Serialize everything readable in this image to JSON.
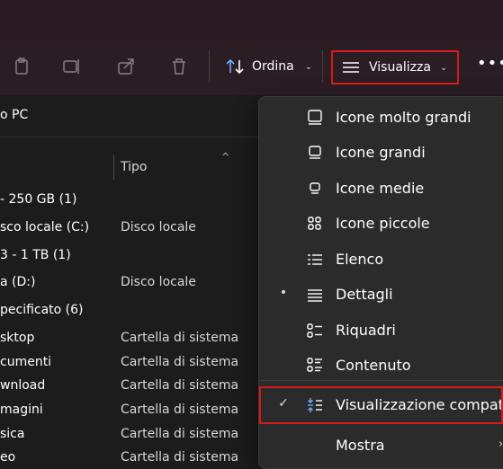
{
  "toolbar": {
    "sort_label": "Ordina",
    "view_label": "Visualizza",
    "more_label": "•••"
  },
  "address": {
    "text": "o PC"
  },
  "columns": {
    "type_header": "Tipo"
  },
  "groups": [
    {
      "label": "- 250 GB (1)"
    },
    {
      "label": "3 - 1 TB (1)"
    },
    {
      "label": "pecificato (6)"
    }
  ],
  "rows": [
    {
      "name": "sco locale (C:)",
      "type": "Disco locale"
    },
    {
      "name": "a (D:)",
      "type": "Disco locale"
    },
    {
      "name": "sktop",
      "type": "Cartella di sistema"
    },
    {
      "name": "cumenti",
      "type": "Cartella di sistema"
    },
    {
      "name": "wnload",
      "type": "Cartella di sistema"
    },
    {
      "name": "magini",
      "type": "Cartella di sistema"
    },
    {
      "name": "sica",
      "type": "Cartella di sistema"
    },
    {
      "name": "eo",
      "type": "Cartella di sistema"
    }
  ],
  "view_menu": {
    "items": [
      {
        "label": "Icone molto grandi",
        "icon": "monitor-large-icon",
        "mark": ""
      },
      {
        "label": "Icone grandi",
        "icon": "monitor-icon",
        "mark": ""
      },
      {
        "label": "Icone medie",
        "icon": "monitor-small-icon",
        "mark": ""
      },
      {
        "label": "Icone piccole",
        "icon": "grid-icon",
        "mark": ""
      },
      {
        "label": "Elenco",
        "icon": "list-icon",
        "mark": ""
      },
      {
        "label": "Dettagli",
        "icon": "details-icon",
        "mark": "•"
      },
      {
        "label": "Riquadri",
        "icon": "tiles-icon",
        "mark": ""
      },
      {
        "label": "Contenuto",
        "icon": "content-icon",
        "mark": ""
      },
      {
        "label": "Visualizzazione compatta",
        "icon": "compact-icon",
        "mark": "✓"
      },
      {
        "label": "Mostra",
        "icon": "",
        "mark": "",
        "arrow": "›"
      }
    ]
  },
  "colors": {
    "highlight": "#d71b1b",
    "toolbar_bg": "#2b1d24",
    "menu_bg": "#2b2b2b"
  }
}
